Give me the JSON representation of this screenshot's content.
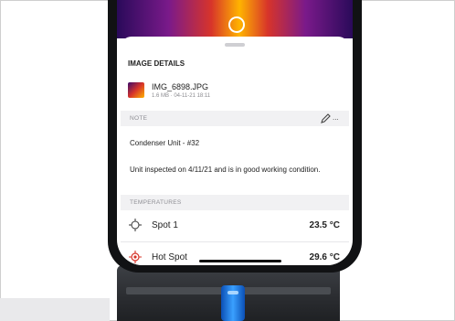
{
  "sheet": {
    "title": "IMAGE DETAILS",
    "file": {
      "name": "IMG_6898.JPG",
      "meta": "1.6 MB · 04-11-21 18:11"
    },
    "note_section": {
      "label": "NOTE",
      "edit_icon": "pencil-icon",
      "more_label": "..."
    },
    "note": {
      "title": "Condenser Unit - #32",
      "body": "Unit inspected on 4/11/21 and is in good working condition."
    },
    "temperatures_section": {
      "label": "TEMPERATURES"
    },
    "temperatures": [
      {
        "label": "Spot 1",
        "value": "23.5 °C",
        "icon": "crosshair-icon"
      },
      {
        "label": "Hot Spot",
        "value": "29.6 °C",
        "icon": "hot-spot-icon"
      }
    ]
  },
  "colors": {
    "hot_accent": "#d7342a",
    "device_button": "#1e78f0"
  }
}
